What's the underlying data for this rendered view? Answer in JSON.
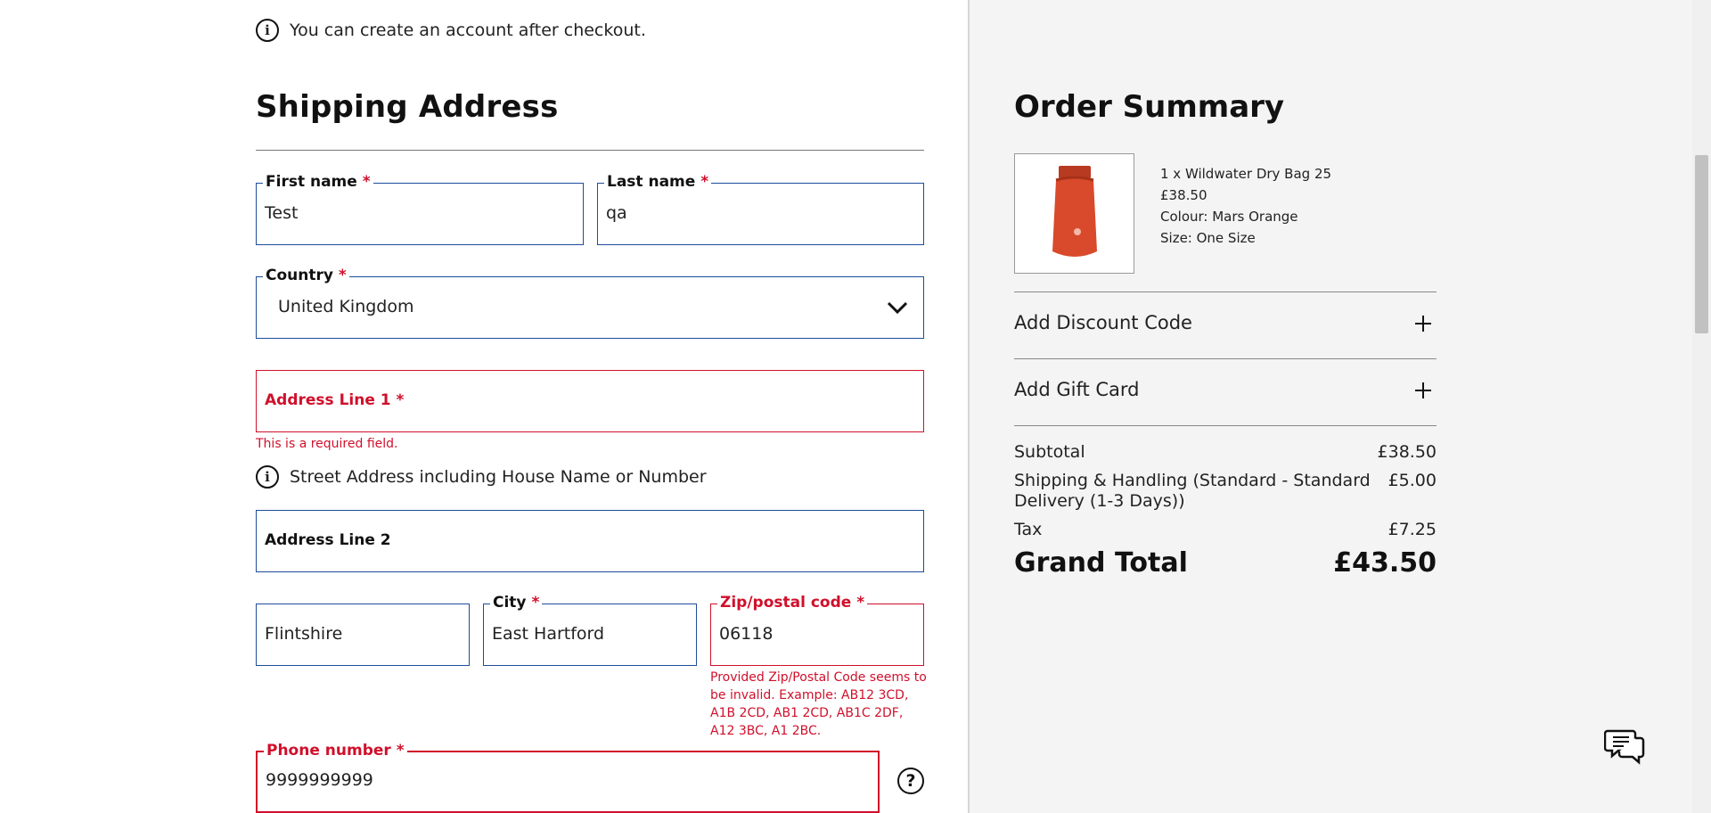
{
  "notice": {
    "text": "You can create an account after checkout."
  },
  "shipping": {
    "title": "Shipping Address",
    "first_name": {
      "label": "First name",
      "value": "Test"
    },
    "last_name": {
      "label": "Last name",
      "value": "qa"
    },
    "country": {
      "label": "Country",
      "value": "United Kingdom"
    },
    "address1": {
      "label": "Address Line 1",
      "value": "",
      "error": "This is a required field."
    },
    "address_hint": "Street Address including House Name or Number",
    "address2": {
      "label": "Address Line 2",
      "value": ""
    },
    "county": {
      "value": "Flintshire"
    },
    "city": {
      "label": "City",
      "value": "East Hartford"
    },
    "zip": {
      "label": "Zip/postal code",
      "value": "06118",
      "error": "Provided Zip/Postal Code seems to be invalid. Example: AB12 3CD, A1B 2CD, AB1 2CD, AB1C 2DF, A12 3BC, A1 2BC."
    },
    "phone": {
      "label": "Phone number",
      "value": "9999999999"
    },
    "required_mark": "*"
  },
  "summary": {
    "title": "Order Summary",
    "item": {
      "line": "1 x Wildwater Dry Bag 25",
      "price": "£38.50",
      "colour": "Colour: Mars Orange",
      "size": "Size: One Size"
    },
    "discount_label": "Add Discount Code",
    "gift_label": "Add Gift Card",
    "subtotal_label": "Subtotal",
    "subtotal_value": "£38.50",
    "shipping_label": "Shipping & Handling (Standard - Standard Delivery (1-3 Days))",
    "shipping_value": "£5.00",
    "tax_label": "Tax",
    "tax_value": "£7.25",
    "grand_label": "Grand Total",
    "grand_value": "£43.50"
  },
  "colors": {
    "accent_border": "#1e4c9a",
    "error": "#d0102b",
    "product": "#d9492b"
  },
  "icons": {
    "info": "info-icon",
    "chevron": "chevron-down-icon",
    "plus": "plus-icon",
    "help": "help-icon",
    "chat": "chat-icon"
  }
}
